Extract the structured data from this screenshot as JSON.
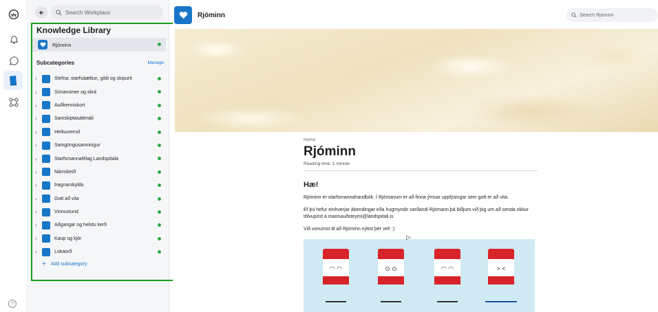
{
  "rail": {
    "icons": [
      "workplace-logo-icon",
      "bell-icon",
      "chat-icon",
      "knowledge-library-icon",
      "groups-icon"
    ],
    "help_icon": "?"
  },
  "sidebar": {
    "search_placeholder": "Search Workplace",
    "title": "Knowledge Library",
    "root_item": "Rjóminn",
    "subcategories_label": "Subcategories",
    "manage_label": "Manage",
    "subcategories": [
      {
        "label": "Stefna, starfsáætlun, gildi og skipurit"
      },
      {
        "label": "Símanúmer og skrá"
      },
      {
        "label": "Auðkenniskort"
      },
      {
        "label": "Samskiptasáttmáli"
      },
      {
        "label": "Heilsuvernd"
      },
      {
        "label": "Samgöngusamningur"
      },
      {
        "label": "Starfsmannafélag Landspítala"
      },
      {
        "label": "Námskeið"
      },
      {
        "label": "Þagnarskylda"
      },
      {
        "label": "Gott að vita"
      },
      {
        "label": "Vinnustund"
      },
      {
        "label": "Aðgangar og helstu kerfi"
      },
      {
        "label": "Kaup og kjör"
      },
      {
        "label": "Lokaorð"
      }
    ],
    "add_subcategory": "Add subcategory"
  },
  "main": {
    "title": "Rjóminn",
    "search_placeholder": "Search Rjóminn",
    "breadcrumb": "Home",
    "article_title": "Rjóminn",
    "reading_time": "Reading time: 1 minute",
    "heading": "Hæ!",
    "paragraph1": "Rjóminn er starfsmannahandbók. Í Rjómanum er að finna ýmsar upplýsingar sem gott er að vita.",
    "paragraph2": "Ef þú hefur einhverjar ábendingar eða hugmyndir varðandi Rjómann þá biðjum við þig um að senda okkur tölvupóst á mannauðsteymi@landspitali.is",
    "paragraph3": "Við vonumst til að Rjóminn nýtist þér vel! :)"
  },
  "colors": {
    "accent": "#1876c8",
    "status_dot": "#2ea84a",
    "highlight": "#1a9b1a",
    "carton_red": "#d8232a"
  }
}
